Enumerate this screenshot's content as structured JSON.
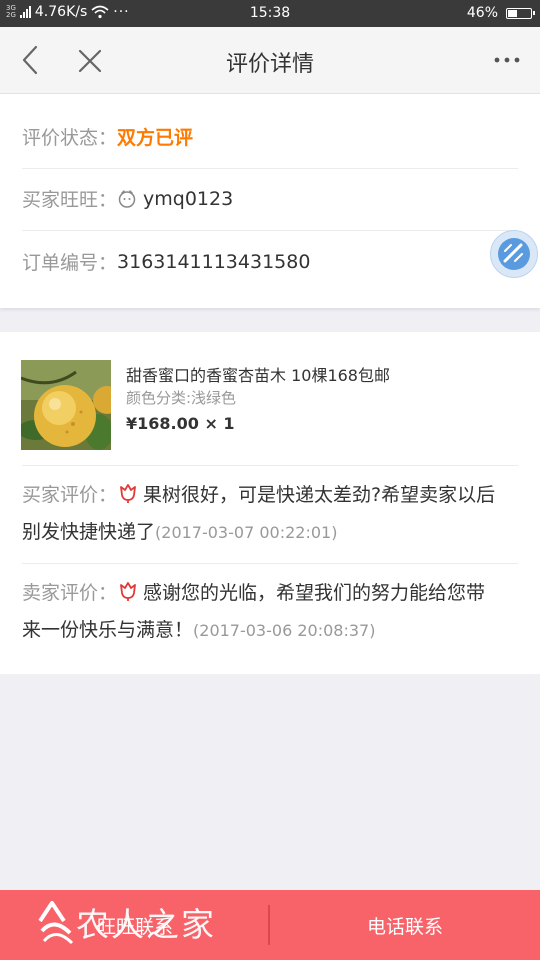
{
  "status_bar": {
    "network_top": "3G",
    "network_bottom": "2G",
    "speed": "4.76K/s",
    "time": "15:38",
    "battery": "46%",
    "battery_level": 0.46,
    "icons": [
      "signal-icon",
      "wifi-icon",
      "more-dots-icon",
      "battery-icon"
    ]
  },
  "nav": {
    "title": "评价详情",
    "icons": [
      "back-chevron-icon",
      "close-icon",
      "more-icon"
    ]
  },
  "info": {
    "status_label": "评价状态：",
    "status_value": "双方已评",
    "buyer_label": "买家旺旺：",
    "buyer_value": "ymq0123",
    "order_label": "订单编号：",
    "order_value": "3163141113431580"
  },
  "product": {
    "title": "甜香蜜口的香蜜杏苗木 10棵168包邮",
    "spec": "颜色分类:浅绿色",
    "price": "¥168.00 × 1"
  },
  "reviews": [
    {
      "label": "买家评价：",
      "text": "果树很好，可是快递太差劲?希望卖家以后别发快捷快递了",
      "date": "(2017-03-07 00:22:01)"
    },
    {
      "label": "卖家评价：",
      "text": "感谢您的光临，希望我们的努力能给您带来一份快乐与满意！",
      "date": "(2017-03-06 20:08:37)"
    }
  ],
  "bottom": {
    "left_label": "旺旺联系",
    "right_label": "电话联系",
    "watermark": "农人之家"
  },
  "colors": {
    "accent_orange": "#ff7a00",
    "bottom_bar": "#f8636a",
    "flower_red": "#e23a3a"
  }
}
